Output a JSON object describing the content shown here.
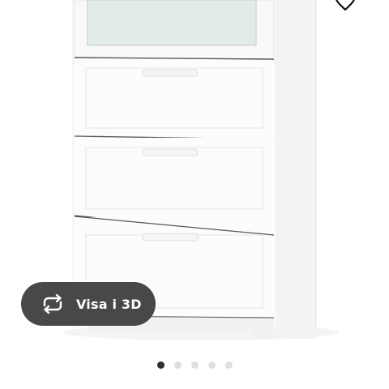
{
  "view_3d": {
    "label": "Visa i 3D",
    "background": "#484848",
    "text_color": "#ffffff"
  },
  "favorite": {
    "icon": "heart-icon"
  },
  "carousel": {
    "count": 5,
    "active_index": 0,
    "active_color": "#2e2e2e",
    "inactive_color": "#dfdfdf"
  },
  "product": {
    "image": "dresser-image",
    "description_icon": "dresser-icon"
  }
}
